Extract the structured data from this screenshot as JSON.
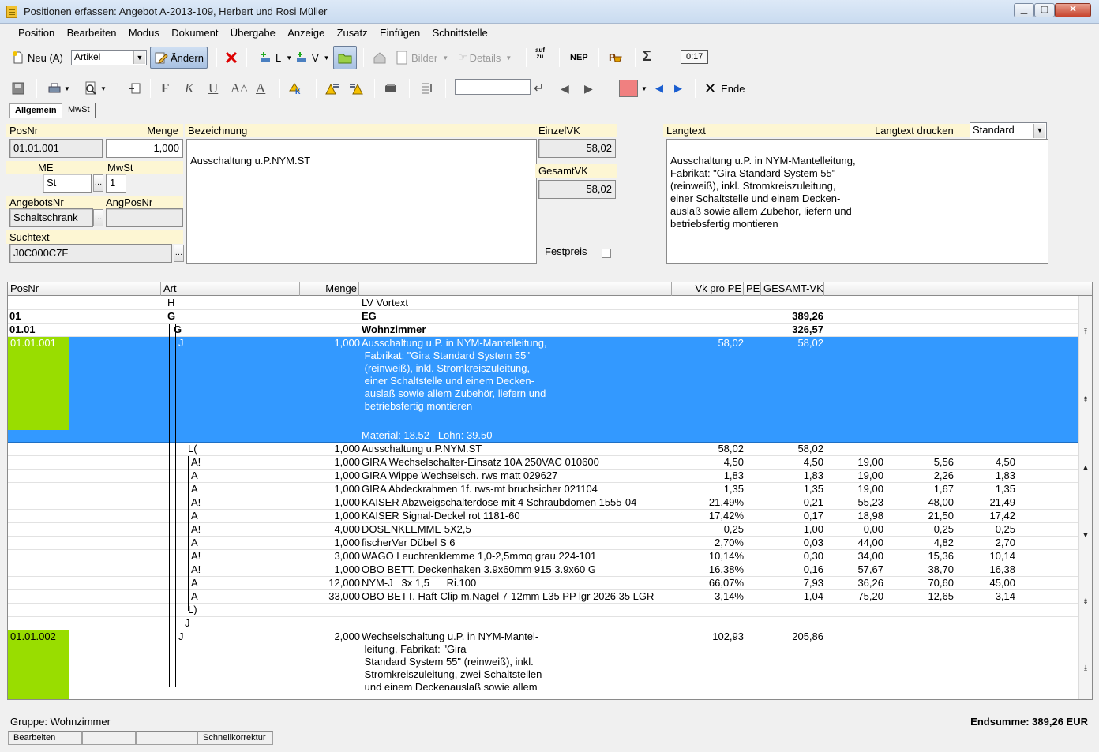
{
  "window": {
    "title": "Positionen erfassen: Angebot A-2013-109, Herbert und Rosi Müller"
  },
  "menu": [
    "Position",
    "Bearbeiten",
    "Modus",
    "Dokument",
    "Übergabe",
    "Anzeige",
    "Zusatz",
    "Einfügen",
    "Schnittstelle"
  ],
  "toolbar1": {
    "new_label": "Neu (A)",
    "type_select": "Artikel",
    "edit_label": "Ändern",
    "l_label": "L",
    "v_label": "V",
    "pictures_label": "Bilder",
    "details_label": "Details",
    "sort_top": "auf",
    "sort_bottom": "zu",
    "nep_label": "NEP",
    "sum_label": "Σ",
    "time_label": "0:17"
  },
  "toolbar2": {
    "bold": "F",
    "italic": "K",
    "underline": "U",
    "search_value": "",
    "end_label": "Ende",
    "color_swatch": "#f08080"
  },
  "tabs": [
    "Allgemein",
    "MwSt"
  ],
  "form": {
    "posnr_label": "PosNr",
    "posnr_value": "01.01.001",
    "menge_label": "Menge",
    "menge_value": "1,000",
    "bezeichnung_label": "Bezeichnung",
    "bezeichnung_value": "Ausschaltung u.P.NYM.ST",
    "einzelvk_label": "EinzelVK",
    "einzelvk_value": "58,02",
    "gesamtvk_label": "GesamtVK",
    "gesamtvk_value": "58,02",
    "me_label": "ME",
    "me_value": "St",
    "mwst_label": "MwSt",
    "mwst_value": "1",
    "angebotsnr_label": "AngebotsNr",
    "angebotsnr_value": "Schaltschrank",
    "angposnr_label": "AngPosNr",
    "angposnr_value": "",
    "suchtext_label": "Suchtext",
    "suchtext_value": "J0C000C7F",
    "festpreis_label": "Festpreis",
    "langtext_label": "Langtext",
    "langtext_drucken_label": "Langtext drucken",
    "langtext_drucken_value": "Standard",
    "langtext_value": "Ausschaltung u.P. in NYM-Mantelleitung,\n Fabrikat: \"Gira Standard System 55\"\n (reinweiß), inkl. Stromkreiszuleitung,\n einer Schaltstelle und einem Decken-\n auslaß sowie allem Zubehör, liefern und\n betriebsfertig montieren"
  },
  "grid": {
    "headers": [
      "PosNr",
      "Art",
      "Menge",
      "Vk pro PE",
      "PE",
      "GESAMT-VK"
    ],
    "rows": [
      {
        "pos": "",
        "art": "H",
        "menge": "",
        "text": "LV Vortext",
        "vk": "",
        "ges": "",
        "c1": "",
        "c2": "",
        "c3": ""
      },
      {
        "pos": "01",
        "art": "G",
        "menge": "",
        "text": "EG",
        "vk": "",
        "ges": "389,26",
        "c1": "",
        "c2": "",
        "c3": ""
      },
      {
        "pos": "01.01",
        "art": "G",
        "menge": "",
        "text": "Wohnzimmer",
        "vk": "",
        "ges": "326,57",
        "c1": "",
        "c2": "",
        "c3": ""
      }
    ],
    "selected": {
      "pos": "01.01.001",
      "art": "J",
      "menge": "1,000",
      "lines": [
        "Ausschaltung u.P. in NYM-Mantelleitung,",
        " Fabrikat: \"Gira Standard System 55\"",
        " (reinweiß), inkl. Stromkreiszuleitung,",
        " einer Schaltstelle und einem Decken-",
        " auslaß sowie allem Zubehör, liefern und",
        " betriebsfertig montieren"
      ],
      "material": "Material: 18.52   Lohn: 39.50",
      "vk": "58,02",
      "ges": "58,02"
    },
    "sub_rows": [
      {
        "art": "L(",
        "menge": "1,000",
        "text": "Ausschaltung u.P.NYM.ST",
        "vk": "58,02",
        "ges": "58,02",
        "c1": "",
        "c2": "",
        "c3": ""
      },
      {
        "art": "A!",
        "menge": "1,000",
        "text": "GIRA Wechselschalter-Einsatz 10A 250VAC 010600",
        "vk": "4,50",
        "ges": "4,50",
        "c1": "19,00",
        "c2": "5,56",
        "c3": "4,50"
      },
      {
        "art": "A",
        "menge": "1,000",
        "text": "GIRA Wippe Wechselsch. rws matt 029627",
        "vk": "1,83",
        "ges": "1,83",
        "c1": "19,00",
        "c2": "2,26",
        "c3": "1,83"
      },
      {
        "art": "A",
        "menge": "1,000",
        "text": "GIRA Abdeckrahmen 1f. rws-mt bruchsicher 021104",
        "vk": "1,35",
        "ges": "1,35",
        "c1": "19,00",
        "c2": "1,67",
        "c3": "1,35"
      },
      {
        "art": "A!",
        "menge": "1,000",
        "text": "KAISER Abzweigschalterdose mit 4 Schraubdomen 1555-04",
        "vk": "21,49%",
        "ges": "0,21",
        "c1": "55,23",
        "c2": "48,00",
        "c3": "21,49"
      },
      {
        "art": "A",
        "menge": "1,000",
        "text": "KAISER Signal-Deckel rot 1181-60",
        "vk": "17,42%",
        "ges": "0,17",
        "c1": "18,98",
        "c2": "21,50",
        "c3": "17,42"
      },
      {
        "art": "A!",
        "menge": "4,000",
        "text": "DOSENKLEMME 5X2,5",
        "vk": "0,25",
        "ges": "1,00",
        "c1": "0,00",
        "c2": "0,25",
        "c3": "0,25"
      },
      {
        "art": "A",
        "menge": "1,000",
        "text": "fischerVer Dübel S 6",
        "vk": "2,70%",
        "ges": "0,03",
        "c1": "44,00",
        "c2": "4,82",
        "c3": "2,70"
      },
      {
        "art": "A!",
        "menge": "3,000",
        "text": "WAGO Leuchtenklemme 1,0-2,5mmq grau 224-101",
        "vk": "10,14%",
        "ges": "0,30",
        "c1": "34,00",
        "c2": "15,36",
        "c3": "10,14"
      },
      {
        "art": "A!",
        "menge": "1,000",
        "text": "OBO BETT. Deckenhaken 3.9x60mm 915 3.9x60 G",
        "vk": "16,38%",
        "ges": "0,16",
        "c1": "57,67",
        "c2": "38,70",
        "c3": "16,38"
      },
      {
        "art": "A",
        "menge": "12,000",
        "text": "NYM-J   3x 1,5      Ri.100",
        "vk": "66,07%",
        "ges": "7,93",
        "c1": "36,26",
        "c2": "70,60",
        "c3": "45,00"
      },
      {
        "art": "A",
        "menge": "33,000",
        "text": "OBO BETT. Haft-Clip m.Nagel 7-12mm L35 PP lgr 2026 35 LGR",
        "vk": "3,14%",
        "ges": "1,04",
        "c1": "75,20",
        "c2": "12,65",
        "c3": "3,14"
      },
      {
        "art": "L)",
        "menge": "",
        "text": "",
        "vk": "",
        "ges": "",
        "c1": "",
        "c2": "",
        "c3": ""
      },
      {
        "art": "J",
        "menge": "",
        "text": "",
        "vk": "",
        "ges": "",
        "c1": "",
        "c2": "",
        "c3": ""
      }
    ],
    "next": {
      "pos": "01.01.002",
      "art": "J",
      "menge": "2,000",
      "lines": [
        "Wechselschaltung u.P. in NYM-Mantel-",
        " leitung, Fabrikat: \"Gira",
        " Standard System 55\" (reinweiß), inkl.",
        " Stromkreiszuleitung, zwei Schaltstellen",
        " und einem Deckenauslaß sowie allem"
      ],
      "vk": "102,93",
      "ges": "205,86"
    }
  },
  "footer": {
    "gruppe": "Gruppe: Wohnzimmer",
    "endsumme": "Endsumme: 389,26 EUR"
  },
  "statusbar": [
    "Bearbeiten",
    "",
    "",
    "Schnellkorrektur"
  ]
}
